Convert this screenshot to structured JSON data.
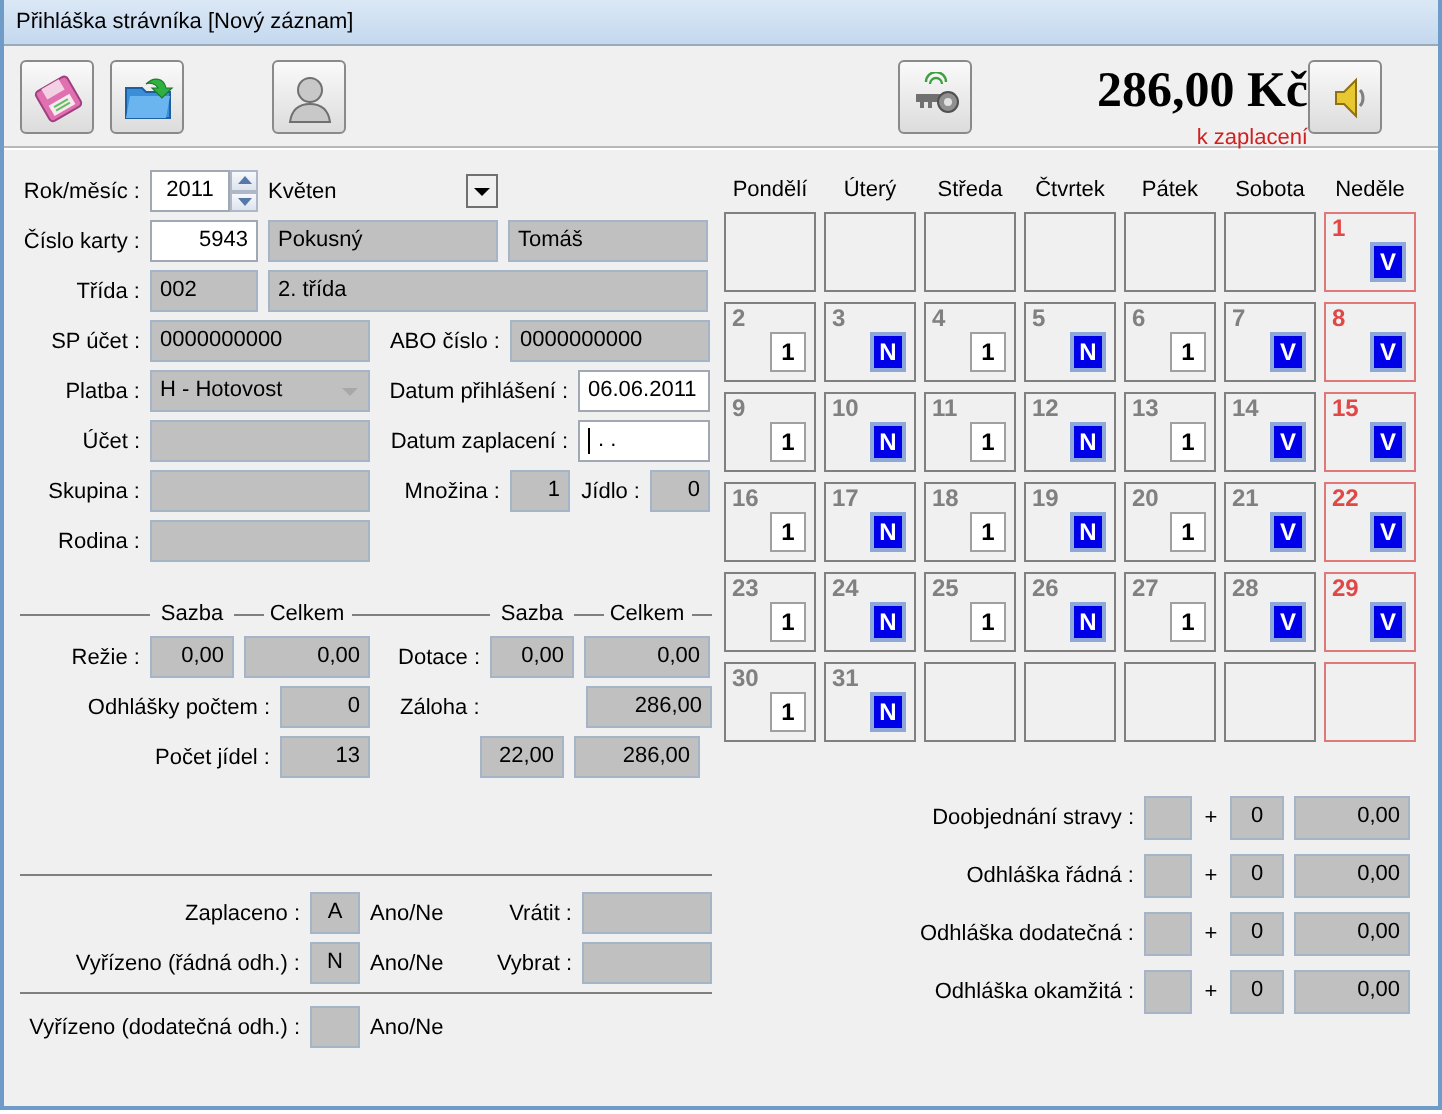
{
  "window": {
    "title": "Přihláška strávníka [Nový záznam]"
  },
  "toolbar": {
    "amount": "286,00 Kč",
    "amount_note": "k zaplacení"
  },
  "form_rows": [
    [
      {
        "kind": "label",
        "text": "Rok/měsíc :"
      },
      {
        "kind": "spin",
        "value": "2011"
      },
      {
        "kind": "dropdown",
        "value": "Květen"
      }
    ],
    [
      {
        "kind": "label",
        "text": "Číslo karty :"
      },
      {
        "kind": "input",
        "value": "5943"
      },
      {
        "kind": "field",
        "value": "Pokusný"
      },
      {
        "kind": "field",
        "value": "Tomáš"
      }
    ],
    [
      {
        "kind": "label",
        "text": "Třída :"
      },
      {
        "kind": "field",
        "value": "002"
      },
      {
        "kind": "field",
        "value": "2. třída"
      }
    ],
    [
      {
        "kind": "label",
        "text": "SP účet :"
      },
      {
        "kind": "field",
        "value": "0000000000"
      },
      {
        "kind": "label",
        "text": "ABO číslo :"
      },
      {
        "kind": "field",
        "value": "0000000000"
      }
    ],
    [
      {
        "kind": "label",
        "text": "Platba :"
      },
      {
        "kind": "combo",
        "value": "H - Hotovost",
        "disabled": true
      },
      {
        "kind": "label",
        "text": "Datum přihlášení :"
      },
      {
        "kind": "input",
        "value": "06.06.2011"
      }
    ],
    [
      {
        "kind": "label",
        "text": "Účet :"
      },
      {
        "kind": "field"
      },
      {
        "kind": "label",
        "text": "Datum zaplacení :"
      },
      {
        "kind": "input",
        "value": ". .",
        "focused": true
      }
    ],
    [
      {
        "kind": "label",
        "text": "Skupina :"
      },
      {
        "kind": "field"
      },
      {
        "kind": "label",
        "text": "Množina :"
      },
      {
        "kind": "field",
        "value": "1"
      },
      {
        "kind": "label",
        "text": "Jídlo :"
      },
      {
        "kind": "field",
        "value": "0"
      }
    ],
    [
      {
        "kind": "label",
        "text": "Rodina :"
      },
      {
        "kind": "field"
      }
    ]
  ],
  "costs": {
    "headings": [
      "Sazba",
      "Celkem",
      "Sazba",
      "Celkem"
    ],
    "rows": [
      {
        "label": "Režie :",
        "rate": "0,00",
        "total": "0,00",
        "label_2": "Dotace :",
        "rate_2": "0,00",
        "total_2": "0,00"
      },
      {
        "label": "Odhlášky počtem :",
        "count": "0",
        "label_2": "Záloha :",
        "total_2": "286,00"
      },
      {
        "label": "Počet jídel :",
        "count": "13",
        "rate_2": "22,00",
        "total_2": "286,00"
      }
    ]
  },
  "settlement": [
    [
      {
        "kind": "label",
        "text": "Zaplaceno :"
      },
      {
        "kind": "field",
        "value": "A"
      },
      {
        "kind": "note",
        "text": "Ano/Ne"
      },
      {
        "kind": "label",
        "text": "Vrátit :"
      },
      {
        "kind": "field"
      }
    ],
    [
      {
        "kind": "label",
        "text": "Vyřízeno (řádná odh.) :"
      },
      {
        "kind": "field",
        "value": "N"
      },
      {
        "kind": "note",
        "text": "Ano/Ne"
      },
      {
        "kind": "label",
        "text": "Vybrat :"
      },
      {
        "kind": "field"
      }
    ],
    [
      {
        "kind": "label",
        "text": "Vyřízeno (dodatečná odh.) :"
      },
      {
        "kind": "field"
      },
      {
        "kind": "note",
        "text": "Ano/Ne"
      }
    ]
  ],
  "calendar": {
    "weekdays": [
      "Pondělí",
      "Úterý",
      "Středa",
      "Čtvrtek",
      "Pátek",
      "Sobota",
      "Neděle"
    ],
    "cells": [
      {
        "kind": "empty"
      },
      {
        "kind": "empty"
      },
      {
        "kind": "empty"
      },
      {
        "kind": "empty"
      },
      {
        "kind": "empty"
      },
      {
        "kind": "empty"
      },
      {
        "kind": "day",
        "day": "1",
        "badge": "V",
        "highlighted": true
      },
      {
        "kind": "day",
        "day": "2",
        "badge": "1",
        "highlighted": false
      },
      {
        "kind": "day",
        "day": "3",
        "badge": "N",
        "highlighted": true
      },
      {
        "kind": "day",
        "day": "4",
        "badge": "1",
        "highlighted": false
      },
      {
        "kind": "day",
        "day": "5",
        "badge": "N",
        "highlighted": true
      },
      {
        "kind": "day",
        "day": "6",
        "badge": "1",
        "highlighted": false
      },
      {
        "kind": "day",
        "day": "7",
        "badge": "V",
        "highlighted": true
      },
      {
        "kind": "day",
        "day": "8",
        "badge": "V",
        "highlighted": true
      },
      {
        "kind": "day",
        "day": "9",
        "badge": "1",
        "highlighted": false
      },
      {
        "kind": "day",
        "day": "10",
        "badge": "N",
        "highlighted": true
      },
      {
        "kind": "day",
        "day": "11",
        "badge": "1",
        "highlighted": false
      },
      {
        "kind": "day",
        "day": "12",
        "badge": "N",
        "highlighted": true
      },
      {
        "kind": "day",
        "day": "13",
        "badge": "1",
        "highlighted": false
      },
      {
        "kind": "day",
        "day": "14",
        "badge": "V",
        "highlighted": true
      },
      {
        "kind": "day",
        "day": "15",
        "badge": "V",
        "highlighted": true
      },
      {
        "kind": "day",
        "day": "16",
        "badge": "1",
        "highlighted": false
      },
      {
        "kind": "day",
        "day": "17",
        "badge": "N",
        "highlighted": true
      },
      {
        "kind": "day",
        "day": "18",
        "badge": "1",
        "highlighted": false
      },
      {
        "kind": "day",
        "day": "19",
        "badge": "N",
        "highlighted": true
      },
      {
        "kind": "day",
        "day": "20",
        "badge": "1",
        "highlighted": false
      },
      {
        "kind": "day",
        "day": "21",
        "badge": "V",
        "highlighted": true
      },
      {
        "kind": "day",
        "day": "22",
        "badge": "V",
        "highlighted": true
      },
      {
        "kind": "day",
        "day": "23",
        "badge": "1",
        "highlighted": false
      },
      {
        "kind": "day",
        "day": "24",
        "badge": "N",
        "highlighted": true
      },
      {
        "kind": "day",
        "day": "25",
        "badge": "1",
        "highlighted": false
      },
      {
        "kind": "day",
        "day": "26",
        "badge": "N",
        "highlighted": true
      },
      {
        "kind": "day",
        "day": "27",
        "badge": "1",
        "highlighted": false
      },
      {
        "kind": "day",
        "day": "28",
        "badge": "V",
        "highlighted": true
      },
      {
        "kind": "day",
        "day": "29",
        "badge": "V",
        "highlighted": true
      },
      {
        "kind": "day",
        "day": "30",
        "badge": "1",
        "highlighted": false
      },
      {
        "kind": "day",
        "day": "31",
        "badge": "N",
        "highlighted": true
      },
      {
        "kind": "empty"
      },
      {
        "kind": "empty"
      },
      {
        "kind": "empty"
      },
      {
        "kind": "empty"
      },
      {
        "kind": "empty"
      }
    ]
  },
  "summary": [
    {
      "label": "Doobjednání stravy :",
      "sign": "+",
      "count": "0",
      "amount": "0,00"
    },
    {
      "label": "Odhláška řádná :",
      "sign": "+",
      "count": "0",
      "amount": "0,00"
    },
    {
      "label": "Odhláška dodatečná :",
      "sign": "+",
      "count": "0",
      "amount": "0,00"
    },
    {
      "label": "Odhláška okamžitá :",
      "sign": "+",
      "count": "0",
      "amount": "0,00"
    }
  ]
}
